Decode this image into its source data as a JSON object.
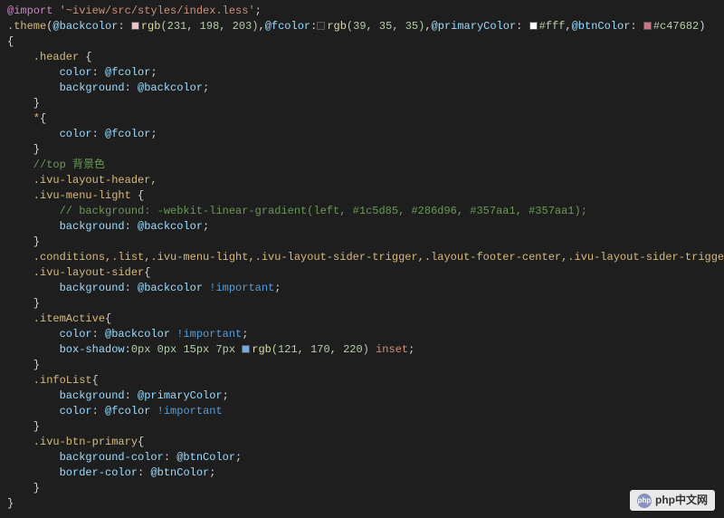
{
  "colors": {
    "swatch1": "rgb(231, 198, 203)",
    "swatch2": "rgb(39, 35, 35)",
    "swatch3": "#ffffff",
    "swatch4": "#c47682",
    "swatch5": "rgb(121, 170, 220)"
  },
  "code": {
    "l1_import": "@import",
    "l1_path": " '~iview/src/styles/index.less'",
    "l1_semi": ";",
    "l2_sel": ".theme",
    "l2_p1": "(",
    "l2_v1": "@backcolor",
    "l2_c1": ": ",
    "l2_rgb1": "rgb",
    "l2_args1": "(231, 198, 203)",
    "l2_comma1": ",",
    "l2_v2": "@fcolor",
    "l2_c2": ":",
    "l2_rgb2": "rgb",
    "l2_args2": "(39, 35, 35)",
    "l2_comma2": ",",
    "l2_v3": "@primaryColor",
    "l2_c3": ": ",
    "l2_val3": "#fff",
    "l2_comma3": ",",
    "l2_v4": "@btnColor",
    "l2_c4": ": ",
    "l2_val4": "#c47682",
    "l2_close": ")",
    "l3": "{",
    "l4_sel": "    .header ",
    "l4_brace": "{",
    "l5_prop": "        color",
    "l5_colon": ": ",
    "l5_val": "@fcolor",
    "l5_semi": ";",
    "l6_prop": "        background",
    "l6_colon": ": ",
    "l6_val": "@backcolor",
    "l6_semi": ";",
    "l7": "    }",
    "l8_sel": "    *",
    "l8_brace": "{",
    "l9_prop": "        color",
    "l9_colon": ": ",
    "l9_val": "@fcolor",
    "l9_semi": ";",
    "l10": "    }",
    "l11_comment": "    //top 背景色",
    "l12_sel": "    .ivu-layout-header,",
    "l13_sel": "    .ivu-menu-light ",
    "l13_brace": "{",
    "l14_comment": "        // background: -webkit-linear-gradient(left, #1c5d85, #286d96, #357aa1, #357aa1);",
    "l15_prop": "        background",
    "l15_colon": ": ",
    "l15_val": "@backcolor",
    "l15_semi": ";",
    "l16": "    }",
    "l17_sel": "    .conditions,.list,.ivu-menu-light,.ivu-layout-sider-trigger,.layout-footer-center,.ivu-layout-sider-trigger,",
    "l18_sel": "    .ivu-layout-sider",
    "l18_brace": "{",
    "l19_prop": "        background",
    "l19_colon": ": ",
    "l19_val": "@backcolor",
    "l19_sp": " ",
    "l19_imp": "!important",
    "l19_semi": ";",
    "l20": "    }",
    "l21_sel": "    .itemActive",
    "l21_brace": "{",
    "l22_prop": "        color",
    "l22_colon": ": ",
    "l22_val": "@backcolor",
    "l22_sp": " ",
    "l22_imp": "!important",
    "l22_semi": ";",
    "l23_prop": "        box-shadow",
    "l23_colon": ":",
    "l23_v1": "0px 0px 15px 7px ",
    "l23_rgb": "rgb",
    "l23_args": "(121, 170, 220)",
    "l23_inset": " inset",
    "l23_semi": ";",
    "l24": "    }",
    "l25_sel": "    .infoList",
    "l25_brace": "{",
    "l26_prop": "        background",
    "l26_colon": ": ",
    "l26_val": "@primaryColor",
    "l26_semi": ";",
    "l27_prop": "        color",
    "l27_colon": ": ",
    "l27_val": "@fcolor",
    "l27_sp": " ",
    "l27_imp": "!important",
    "l28": "    }",
    "l29_sel": "    .ivu-btn-primary",
    "l29_brace": "{",
    "l30_prop": "        background-color",
    "l30_colon": ": ",
    "l30_val": "@btnColor",
    "l30_semi": ";",
    "l31_prop": "        border-color",
    "l31_colon": ": ",
    "l31_val": "@btnColor",
    "l31_semi": ";",
    "l32": "    }",
    "l33": "}"
  },
  "watermark": {
    "logo": "php",
    "text": "php中文网"
  }
}
